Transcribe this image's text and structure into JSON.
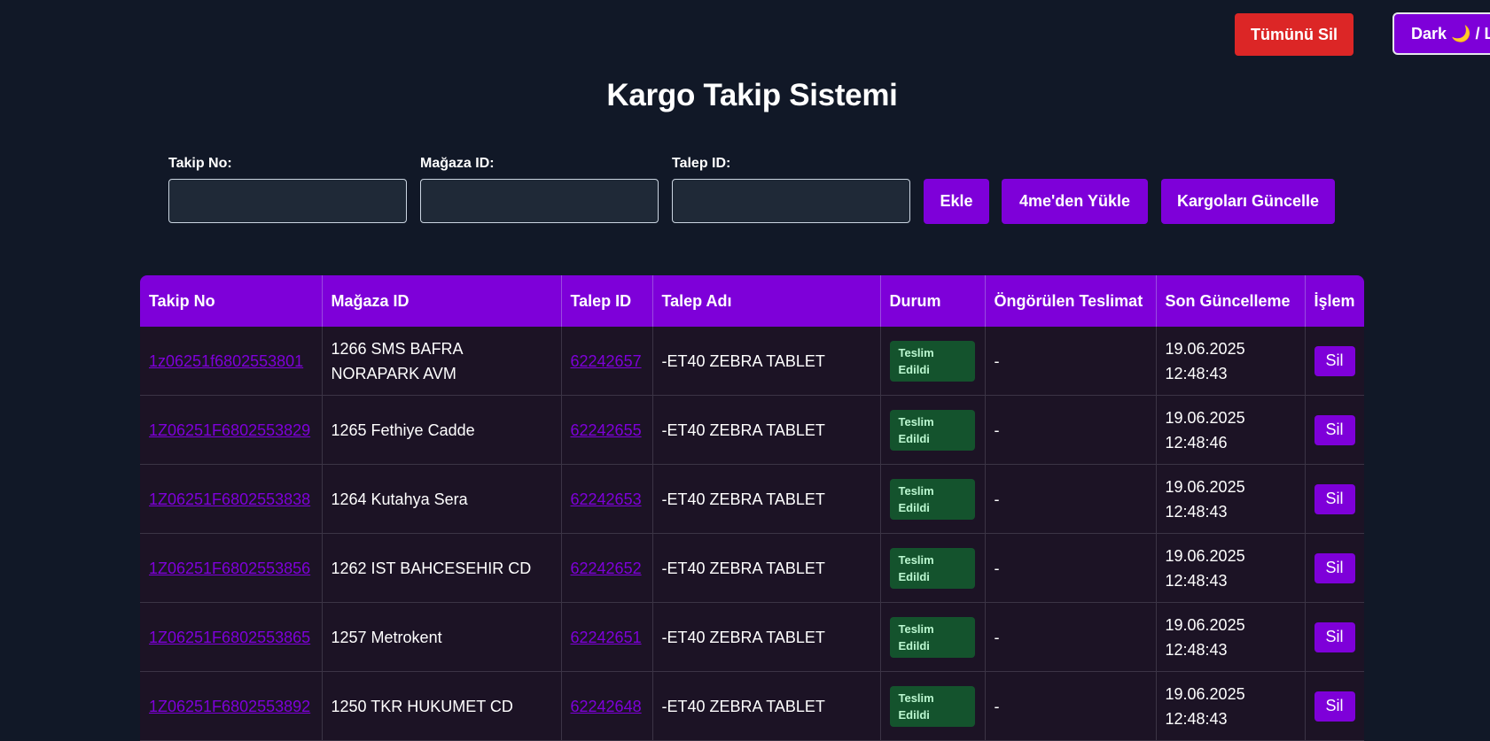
{
  "header": {
    "delete_all_label": "Tümünü Sil",
    "theme_toggle_label": "Dark 🌙 / Light ☀",
    "title": "Kargo Takip Sistemi"
  },
  "form": {
    "takip_no_label": "Takip No:",
    "magaza_id_label": "Mağaza ID:",
    "talep_id_label": "Talep ID:",
    "takip_no_value": "",
    "magaza_id_value": "",
    "talep_id_value": "",
    "add_label": "Ekle",
    "load_label": "4me'den Yükle",
    "update_label": "Kargoları Güncelle"
  },
  "table": {
    "headers": [
      "Takip No",
      "Mağaza ID",
      "Talep ID",
      "Talep Adı",
      "Durum",
      "Öngörülen Teslimat",
      "Son Güncelleme",
      "İşlem"
    ],
    "rows": [
      {
        "takip_no": "1z06251f6802553801",
        "magaza": "1266 SMS BAFRA NORAPARK AVM",
        "talep_id": "62242657",
        "talep_adi": "-ET40 ZEBRA TABLET",
        "durum": "Teslim Edildi",
        "ongorulen": "-",
        "tarih": "19.06.2025",
        "saat": "12:48:43",
        "islem": "Sil"
      },
      {
        "takip_no": "1Z06251F6802553829",
        "magaza": "1265 Fethiye Cadde",
        "talep_id": "62242655",
        "talep_adi": "-ET40 ZEBRA TABLET",
        "durum": "Teslim Edildi",
        "ongorulen": "-",
        "tarih": "19.06.2025",
        "saat": "12:48:46",
        "islem": "Sil"
      },
      {
        "takip_no": "1Z06251F6802553838",
        "magaza": "1264 Kutahya Sera",
        "talep_id": "62242653",
        "talep_adi": "-ET40 ZEBRA TABLET",
        "durum": "Teslim Edildi",
        "ongorulen": "-",
        "tarih": "19.06.2025",
        "saat": "12:48:43",
        "islem": "Sil"
      },
      {
        "takip_no": "1Z06251F6802553856",
        "magaza": "1262 IST BAHCESEHIR CD",
        "talep_id": "62242652",
        "talep_adi": "-ET40 ZEBRA TABLET",
        "durum": "Teslim Edildi",
        "ongorulen": "-",
        "tarih": "19.06.2025",
        "saat": "12:48:43",
        "islem": "Sil"
      },
      {
        "takip_no": "1Z06251F6802553865",
        "magaza": "1257 Metrokent",
        "talep_id": "62242651",
        "talep_adi": "-ET40 ZEBRA TABLET",
        "durum": "Teslim Edildi",
        "ongorulen": "-",
        "tarih": "19.06.2025",
        "saat": "12:48:43",
        "islem": "Sil"
      },
      {
        "takip_no": "1Z06251F6802553892",
        "magaza": "1250 TKR HUKUMET CD",
        "talep_id": "62242648",
        "talep_adi": "-ET40 ZEBRA TABLET",
        "durum": "Teslim Edildi",
        "ongorulen": "-",
        "tarih": "19.06.2025",
        "saat": "12:48:43",
        "islem": "Sil"
      }
    ]
  },
  "colors": {
    "background": "#111827",
    "accent": "#7e00d9",
    "danger": "#dc2626",
    "badge_bg": "#14532d",
    "badge_text": "#bbf7d0",
    "row_bg": "#1c1325"
  }
}
